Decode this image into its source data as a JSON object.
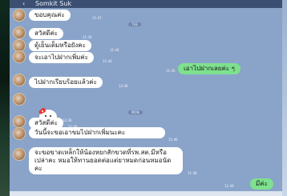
{
  "header": {
    "back_icon": "chevron-left-icon",
    "title": "Somkit Suk"
  },
  "date_chips": [
    {
      "label": "TUE"
    },
    {
      "label": "MON"
    }
  ],
  "messages": [
    {
      "text": "ขอบคุณค่ะ",
      "time": "11:47"
    },
    {
      "text": "สวัสดีค่ะ",
      "time": "11:44"
    },
    {
      "text": "ตู้เย็นเต็มหรือยังคะ",
      "time": "11:44"
    },
    {
      "text": "จะเอาไปฝากเพิ่มค่ะ",
      "time": "11:44"
    },
    {
      "text": "เอาไปฝากเลยค่ะ ๆ",
      "time": "11:45"
    },
    {
      "text": "ไปฝากเรียบร้อยแล้วค่ะ",
      "time": "12:46"
    },
    {
      "text": "sticker",
      "time": "12:46"
    },
    {
      "text": "สวัสดีค่ะ",
      "time": "11:46"
    },
    {
      "text": "วันนี้จะขอเอาขมไปฝากเพิ่มนะคะ",
      "time": "11:46"
    },
    {
      "text": "จะขอขาดเหล็กให้น้องหยกสักขวดที่รพ.สต.มีหรือเปล่าคะ หมอให้ทานยอดต่อแต่ยาหมดก่อนหมอนัดคะ",
      "time": "11:48"
    },
    {
      "text": "มีค่ะ",
      "time": "11:49"
    }
  ]
}
